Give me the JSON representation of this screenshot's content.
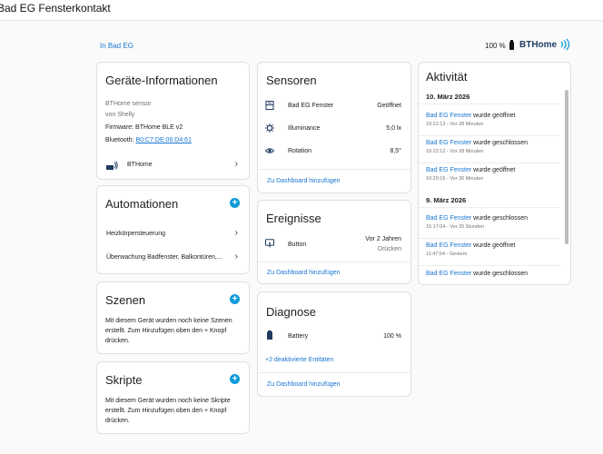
{
  "window": {
    "title": "Bad EG Fensterkontakt"
  },
  "header": {
    "area_link": "In Bad EG",
    "battery": "100 %",
    "brand": "BTHome"
  },
  "device_info": {
    "title": "Geräte-Informationen",
    "model": "BTHome sensor",
    "manufacturer": "von Shelly",
    "firmware_label": "Firmware: BTHome BLE v2",
    "bluetooth_label": "Bluetooth:",
    "bluetooth_mac": "B0:C7:DE:06:D4:61",
    "integration": "BTHome"
  },
  "automations": {
    "title": "Automationen",
    "items": [
      "Heizkörpersteuerung",
      "Überwachung Badfenster, Balkontüren,..."
    ]
  },
  "scenes": {
    "title": "Szenen",
    "text": "Mit diesem Gerät wurden noch keine Szenen erstellt. Zum Hinzufügen oben den + Knopf drücken."
  },
  "scripts": {
    "title": "Skripte",
    "text": "Mit diesem Gerät wurden noch keine Skripte erstellt. Zum Hinzufügen oben den + Knopf drücken."
  },
  "sensors": {
    "title": "Sensoren",
    "rows": [
      {
        "name": "Bad EG Fenster",
        "value": "Geöffnet",
        "icon": "window-icon"
      },
      {
        "name": "Illuminance",
        "value": "5,0 lx",
        "icon": "brightness-icon"
      },
      {
        "name": "Rotation",
        "value": "8,5°",
        "icon": "eye-icon"
      }
    ],
    "footer": "Zu Dashboard hinzufügen"
  },
  "events": {
    "title": "Ereignisse",
    "row": {
      "name": "Button",
      "value_line1": "Vor 2 Jahren",
      "value_line2": "Drücken",
      "icon": "button-press-icon"
    },
    "footer": "Zu Dashboard hinzufügen"
  },
  "diagnostics": {
    "title": "Diagnose",
    "row": {
      "name": "Battery",
      "value": "100 %",
      "icon": "battery-icon"
    },
    "disabled_link": "+2 deaktivierte Entitäten",
    "footer": "Zu Dashboard hinzufügen"
  },
  "activity": {
    "title": "Aktivität",
    "groups": [
      {
        "date": "10. März 2026",
        "items": [
          {
            "entity": "Bad EG Fenster",
            "action": " wurde geöffnet",
            "time": "10:22:13 - Vor 28 Minuten"
          },
          {
            "entity": "Bad EG Fenster",
            "action": " wurde geschlossen",
            "time": "10:22:12 - Vor 28 Minuten"
          },
          {
            "entity": "Bad EG Fenster",
            "action": " wurde geöffnet",
            "time": "10:20:16 - Vor 30 Minuten"
          }
        ]
      },
      {
        "date": "9. März 2026",
        "items": [
          {
            "entity": "Bad EG Fenster",
            "action": " wurde geschlossen",
            "time": "15:17:04 - Vor 20 Stunden"
          },
          {
            "entity": "Bad EG Fenster",
            "action": " wurde geöffnet",
            "time": "11:47:54 - Gestern"
          },
          {
            "entity": "Bad EG Fenster",
            "action": " wurde geschlossen",
            "time": ""
          }
        ]
      }
    ]
  },
  "colors": {
    "accent": "#1976d2",
    "plus": "#0f9bd8",
    "brand": "#1e3a5f"
  }
}
